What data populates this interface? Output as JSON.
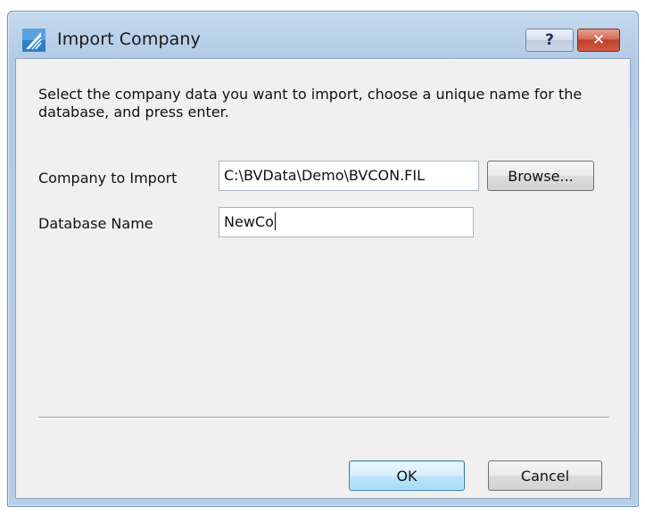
{
  "window": {
    "title": "Import Company",
    "help_glyph": "?",
    "close_glyph": "✕"
  },
  "body": {
    "instruction": "Select the company data you want to import, choose a unique name for the database, and press enter."
  },
  "form": {
    "company_label": "Company to Import",
    "company_value": "C:\\BVData\\Demo\\BVCON.FIL",
    "browse_label": "Browse...",
    "database_label": "Database Name",
    "database_value": "NewCo"
  },
  "footer": {
    "ok_label": "OK",
    "cancel_label": "Cancel"
  },
  "icons": {
    "app": "app-logo-icon",
    "help": "help-icon",
    "close": "close-icon"
  },
  "colors": {
    "title_bar": "#b3cbe6",
    "close_button": "#c0402a",
    "default_button_border": "#3c7fb1",
    "dialog_background": "#f0f0f0"
  }
}
